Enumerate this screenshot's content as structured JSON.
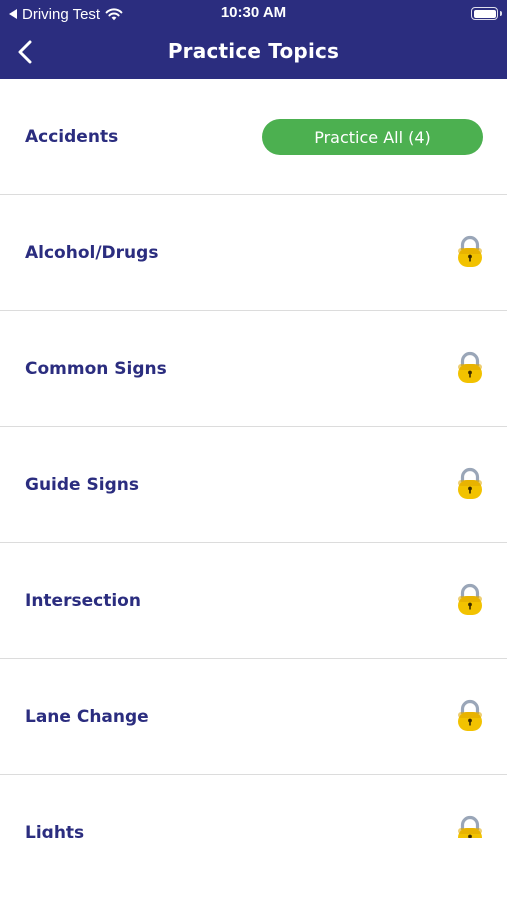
{
  "status_bar": {
    "carrier": "Driving Test",
    "time": "10:30 AM",
    "back_app_icon": "triangle-left-icon",
    "wifi_icon": "wifi-icon",
    "battery_icon": "battery-icon"
  },
  "nav": {
    "back_icon": "chevron-left-icon",
    "title": "Practice Topics"
  },
  "colors": {
    "header_bg": "#2b2d7f",
    "label_text": "#2b2d7f",
    "practice_button_bg": "#4cb050",
    "lock_body": "#f2c200",
    "lock_shackle": "#9aa6b8",
    "divider": "#dcdcdc"
  },
  "topics": [
    {
      "label": "Accidents",
      "action_label": "Practice All (4)",
      "locked": false
    },
    {
      "label": "Alcohol/Drugs",
      "locked": true,
      "icon": "lock-icon"
    },
    {
      "label": "Common Signs",
      "locked": true,
      "icon": "lock-icon"
    },
    {
      "label": "Guide Signs",
      "locked": true,
      "icon": "lock-icon"
    },
    {
      "label": "Intersection",
      "locked": true,
      "icon": "lock-icon"
    },
    {
      "label": "Lane Change",
      "locked": true,
      "icon": "lock-icon"
    },
    {
      "label": "Lights",
      "locked": true,
      "icon": "lock-icon"
    }
  ]
}
